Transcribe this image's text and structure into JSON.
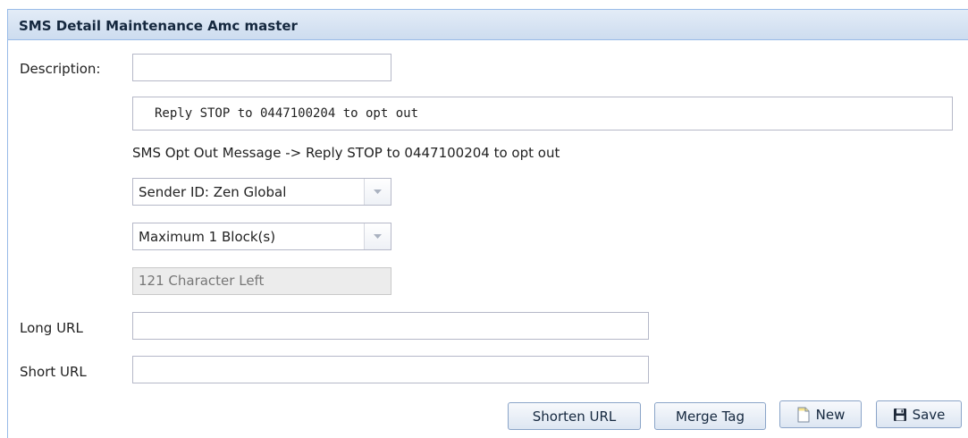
{
  "panel": {
    "title": "SMS Detail Maintenance Amc master"
  },
  "form": {
    "description_label": "Description:",
    "description_value": "",
    "opt_out_value": "Reply STOP to 0447100204 to opt out",
    "opt_out_message": "SMS Opt Out Message -> Reply STOP to 0447100204 to opt out",
    "sender_id": "Sender ID: Zen Global",
    "max_blocks": "Maximum 1 Block(s)",
    "chars_left": "121 Character Left",
    "long_url_label": "Long URL",
    "long_url_value": "",
    "short_url_label": "Short URL",
    "short_url_value": ""
  },
  "toolbar": {
    "shorten_url": "Shorten URL",
    "merge_tag": "Merge Tag",
    "new": "New",
    "save": "Save"
  },
  "icons": {
    "combo_trigger": "chevron-down-icon",
    "new": "new-document-icon",
    "save": "floppy-disk-icon"
  }
}
